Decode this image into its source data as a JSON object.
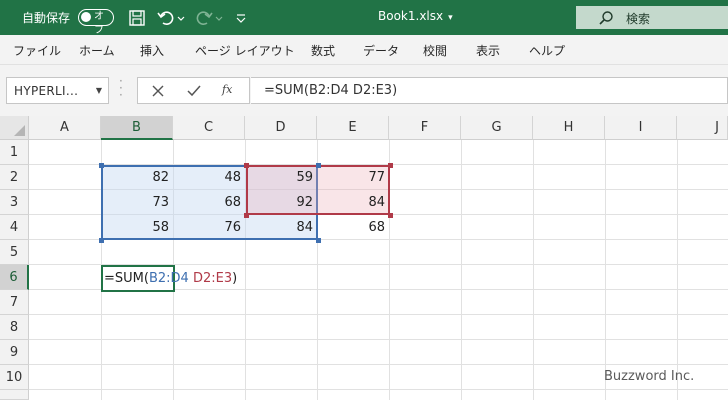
{
  "titlebar": {
    "autosave_label": "自動保存",
    "toggle_label": "オフ",
    "document_title": "Book1.xlsx",
    "search_label": "検索"
  },
  "menu": [
    "ファイル",
    "ホーム",
    "挿入",
    "ページ レイアウト",
    "数式",
    "データ",
    "校閲",
    "表示",
    "ヘルプ"
  ],
  "formula_bar": {
    "name_box": "HYPERLI...",
    "formula": "=SUM(B2:D4 D2:E3)"
  },
  "columns": [
    "A",
    "B",
    "C",
    "D",
    "E",
    "F",
    "G",
    "H",
    "I",
    "J"
  ],
  "rows": [
    "1",
    "2",
    "3",
    "4",
    "5",
    "6",
    "7",
    "8",
    "9",
    "10"
  ],
  "cells": {
    "B2": "82",
    "C2": "48",
    "D2": "59",
    "E2": "77",
    "B3": "73",
    "C3": "68",
    "D3": "92",
    "E3": "84",
    "B4": "58",
    "C4": "76",
    "D4": "84",
    "E4": "68"
  },
  "active_cell": {
    "prefix": "=SUM(",
    "ref1": "B2:D4",
    "space": " ",
    "ref2": "D2:E3",
    "suffix": ")"
  },
  "colors": {
    "excel_green": "#217346",
    "ref1_blue": "#3e6fb0",
    "ref2_red": "#b03a48"
  },
  "watermark": "Buzzword Inc."
}
